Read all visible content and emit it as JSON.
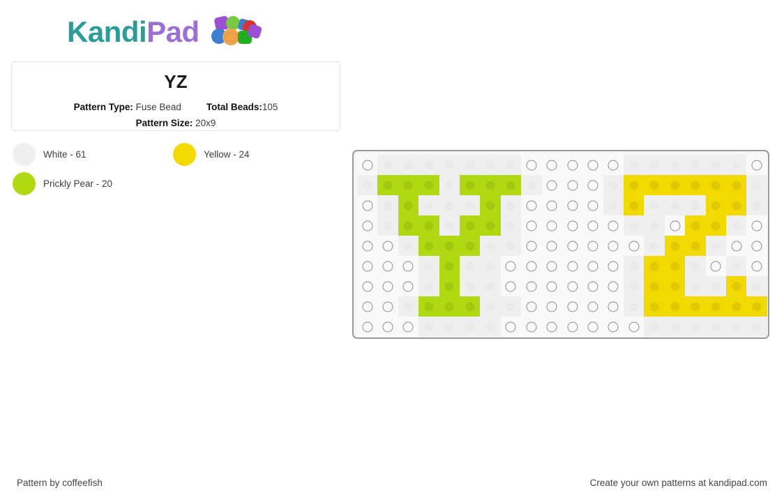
{
  "brand": {
    "name_part1": "Kandi",
    "name_part2": "Pad",
    "color_teal": "#2a9d98",
    "color_purple": "#9b6fd4",
    "beads_icon": "kandi-beads-icon"
  },
  "info": {
    "title": "YZ",
    "pattern_type_label": "Pattern Type:",
    "pattern_type_value": "Fuse Bead",
    "total_beads_label": "Total Beads:",
    "total_beads_value": "105",
    "pattern_size_label": "Pattern Size:",
    "pattern_size_value": "20x9"
  },
  "legend": [
    {
      "name": "White",
      "count": 61,
      "label": "White - 61",
      "color": "#efefef"
    },
    {
      "name": "Yellow",
      "count": 24,
      "label": "Yellow - 24",
      "color": "#f2d900"
    },
    {
      "name": "Prickly Pear",
      "count": 20,
      "label": "Prickly Pear - 20",
      "color": "#b0d911"
    }
  ],
  "board": {
    "columns": 20,
    "rows": 9,
    "palette": {
      "0": "#f9f9f9",
      "W": "#efefef",
      "Y": "#f2d900",
      "G": "#b0d911"
    },
    "cells": [
      [
        "0",
        "W",
        "W",
        "W",
        "W",
        "W",
        "W",
        "W",
        "0",
        "0",
        "0",
        "0",
        "0",
        "W",
        "W",
        "W",
        "W",
        "W",
        "W",
        "0"
      ],
      [
        "W",
        "G",
        "G",
        "G",
        "W",
        "G",
        "G",
        "G",
        "W",
        "0",
        "0",
        "0",
        "W",
        "Y",
        "Y",
        "Y",
        "Y",
        "Y",
        "Y",
        "W"
      ],
      [
        "0",
        "W",
        "G",
        "W",
        "W",
        "W",
        "G",
        "W",
        "0",
        "0",
        "0",
        "0",
        "W",
        "Y",
        "W",
        "W",
        "W",
        "Y",
        "Y",
        "W"
      ],
      [
        "0",
        "W",
        "G",
        "G",
        "W",
        "G",
        "G",
        "W",
        "0",
        "0",
        "0",
        "0",
        "0",
        "W",
        "W",
        "0",
        "Y",
        "Y",
        "W",
        "0"
      ],
      [
        "0",
        "0",
        "W",
        "G",
        "G",
        "G",
        "W",
        "W",
        "0",
        "0",
        "0",
        "0",
        "0",
        "0",
        "W",
        "Y",
        "Y",
        "W",
        "0",
        "0"
      ],
      [
        "0",
        "0",
        "0",
        "W",
        "G",
        "W",
        "W",
        "0",
        "0",
        "0",
        "0",
        "0",
        "0",
        "W",
        "Y",
        "Y",
        "W",
        "0",
        "W",
        "0"
      ],
      [
        "0",
        "0",
        "0",
        "W",
        "G",
        "W",
        "W",
        "0",
        "0",
        "0",
        "0",
        "0",
        "0",
        "W",
        "Y",
        "Y",
        "W",
        "W",
        "Y",
        "W"
      ],
      [
        "0",
        "0",
        "W",
        "G",
        "G",
        "G",
        "W",
        "W",
        "0",
        "0",
        "0",
        "0",
        "0",
        "W",
        "Y",
        "Y",
        "Y",
        "Y",
        "Y",
        "Y"
      ],
      [
        "0",
        "0",
        "0",
        "W",
        "W",
        "W",
        "W",
        "0",
        "0",
        "0",
        "0",
        "0",
        "0",
        "0",
        "W",
        "W",
        "W",
        "W",
        "W",
        "W"
      ]
    ]
  },
  "footer": {
    "left": "Pattern by coffeefish",
    "right": "Create your own patterns at kandipad.com"
  }
}
